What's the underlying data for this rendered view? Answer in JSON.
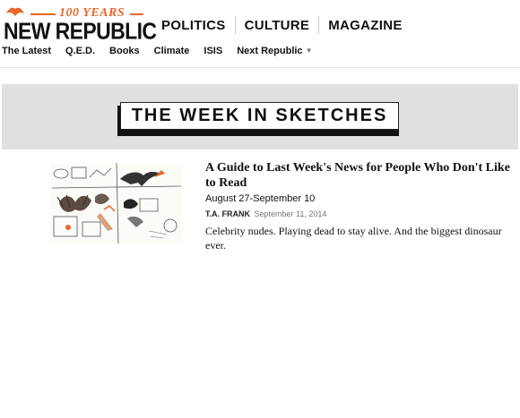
{
  "header": {
    "logo_years": "100 YEARS",
    "logo_name": "NEW REPUBLIC",
    "main_nav": [
      "POLITICS",
      "CULTURE",
      "MAGAZINE"
    ],
    "sub_nav": [
      "The Latest",
      "Q.E.D.",
      "Books",
      "Climate",
      "ISIS",
      "Next Republic"
    ]
  },
  "banner": {
    "title": "THE WEEK IN SKETCHES"
  },
  "article": {
    "thumbnail_icon": "sketch-collage-thumbnail",
    "headline": "A Guide to Last Week's News for People Who Don't Like to Read",
    "dek": "August 27-September 10",
    "author": "T.A. FRANK",
    "date": "September 11, 2014",
    "summary": "Celebrity nudes. Playing dead to stay alive. And the biggest dinosaur ever."
  },
  "colors": {
    "brand": "#e8672a",
    "banner_bg": "#e0e0e0",
    "text": "#111111"
  }
}
